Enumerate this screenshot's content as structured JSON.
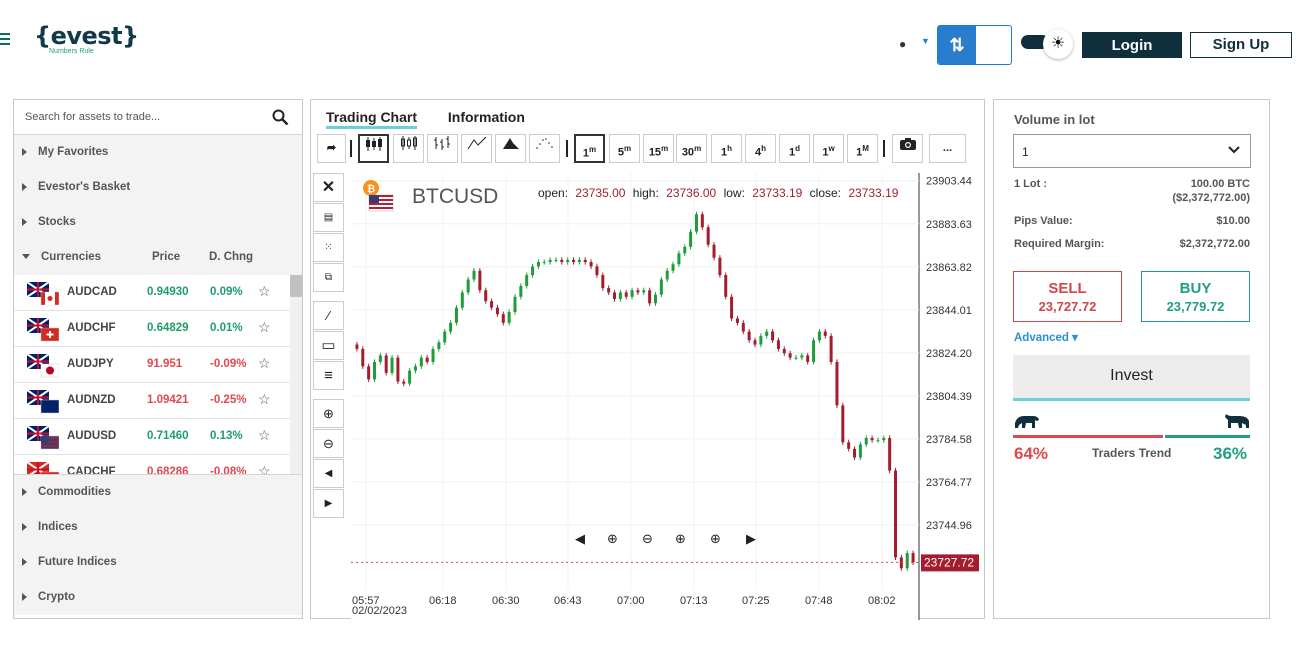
{
  "header": {
    "logo_text": "{evest}",
    "logo_tagline": "Numbers Rule",
    "login_label": "Login",
    "signup_label": "Sign Up"
  },
  "left_panel": {
    "search_placeholder": "Search for assets to trade...",
    "categories_top": [
      "My Favorites",
      "Evestor's Basket",
      "Stocks"
    ],
    "currencies": {
      "label": "Currencies",
      "price_header": "Price",
      "change_header": "D. Chng",
      "rows": [
        {
          "symbol": "AUDCAD",
          "price": "0.94930",
          "change": "0.09%",
          "direction": "up"
        },
        {
          "symbol": "AUDCHF",
          "price": "0.64829",
          "change": "0.01%",
          "direction": "up"
        },
        {
          "symbol": "AUDJPY",
          "price": "91.951",
          "change": "-0.09%",
          "direction": "down"
        },
        {
          "symbol": "AUDNZD",
          "price": "1.09421",
          "change": "-0.25%",
          "direction": "down"
        },
        {
          "symbol": "AUDUSD",
          "price": "0.71460",
          "change": "0.13%",
          "direction": "up"
        },
        {
          "symbol": "CADCHF",
          "price": "0.68286",
          "change": "-0.08%",
          "direction": "down"
        }
      ]
    },
    "categories_bottom": [
      "Commodities",
      "Indices",
      "Future Indices",
      "Crypto"
    ]
  },
  "chart_panel": {
    "tabs": [
      "Trading Chart",
      "Information"
    ],
    "intervals": [
      "1m",
      "5m",
      "15m",
      "30m",
      "1h",
      "4h",
      "1d",
      "1w",
      "1M"
    ],
    "selected_interval": "1m",
    "more_label": "..."
  },
  "chart_data": {
    "type": "candlestick",
    "symbol": "BTCUSD",
    "ohlc_label": {
      "open_label": "open:",
      "open": "23735.00",
      "high_label": "high:",
      "high": "23736.00",
      "low_label": "low:",
      "low": "23733.19",
      "close_label": "close:",
      "close": "23733.19"
    },
    "y_ticks": [
      23903.44,
      23883.63,
      23863.82,
      23844.01,
      23824.2,
      23804.39,
      23784.58,
      23764.77,
      23744.96
    ],
    "y_tick_labels": [
      "23903.44",
      "23883.63",
      "23863.82",
      "23844.01",
      "23824.20",
      "23804.39",
      "23784.58",
      "23764.77",
      "23744.96"
    ],
    "y_range": [
      23715,
      23907
    ],
    "x_tick_labels": [
      "05:57",
      "06:18",
      "06:30",
      "06:43",
      "07:00",
      "07:13",
      "07:25",
      "07:48",
      "08:02"
    ],
    "x_date_label": "02/02/2023",
    "current_price": 23727.72,
    "current_price_label": "23727.72",
    "colors": {
      "up": "#1e9e3a",
      "down": "#a31d2e"
    },
    "closes": [
      23826,
      23818,
      23812,
      23820,
      23823,
      23815,
      23822,
      23811,
      23810,
      23816,
      23818,
      23822,
      23820,
      23826,
      23829,
      23834,
      23838,
      23845,
      23852,
      23858,
      23862,
      23853,
      23848,
      23845,
      23842,
      23838,
      23843,
      23850,
      23855,
      23860,
      23864,
      23866,
      23866,
      23867,
      23867,
      23866,
      23867,
      23866,
      23867,
      23866,
      23864,
      23860,
      23854,
      23852,
      23849,
      23852,
      23850,
      23853,
      23852,
      23853,
      23847,
      23851,
      23858,
      23862,
      23865,
      23870,
      23873,
      23880,
      23888,
      23882,
      23874,
      23868,
      23860,
      23850,
      23840,
      23838,
      23834,
      23830,
      23828,
      23832,
      23834,
      23830,
      23826,
      23824,
      23822,
      23822,
      23823,
      23820,
      23830,
      23834,
      23832,
      23820,
      23800,
      23783,
      23780,
      23776,
      23782,
      23785,
      23784,
      23784,
      23785,
      23770,
      23730,
      23725,
      23732,
      23727.72
    ]
  },
  "right_panel": {
    "volume_title": "Volume in lot",
    "volume_value": "1",
    "lot_label": "1 Lot :",
    "lot_value": "100.00 BTC",
    "lot_value_usd": "($2,372,772.00)",
    "pips_label": "Pips Value:",
    "pips_value": "$10.00",
    "margin_label": "Required Margin:",
    "margin_value": "$2,372,772.00",
    "sell_label": "SELL",
    "sell_price": "23,727.72",
    "buy_label": "BUY",
    "buy_price": "23,779.72",
    "advanced_label": "Advanced",
    "invest_label": "Invest",
    "bear_pct": "64%",
    "bull_pct": "36%",
    "bear_share": 0.64,
    "trend_label": "Traders Trend"
  }
}
